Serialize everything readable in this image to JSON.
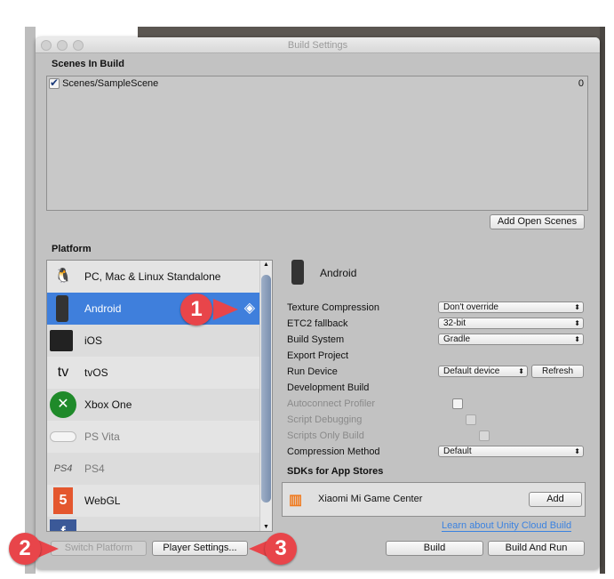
{
  "window": {
    "title": "Build Settings"
  },
  "scenes": {
    "header": "Scenes In Build",
    "items": [
      {
        "name": "Scenes/SampleScene",
        "index": "0",
        "checked": true
      }
    ],
    "add_open_scenes": "Add Open Scenes"
  },
  "platform": {
    "header": "Platform",
    "items": [
      {
        "label": "PC, Mac & Linux Standalone",
        "icon": "pc-mac-linux-icon"
      },
      {
        "label": "Android",
        "icon": "android-icon",
        "selected": true,
        "active": true
      },
      {
        "label": "iOS",
        "icon": "ios-icon"
      },
      {
        "label": "tvOS",
        "icon": "tvos-icon"
      },
      {
        "label": "Xbox One",
        "icon": "xbox-icon"
      },
      {
        "label": "PS Vita",
        "icon": "ps-vita-icon"
      },
      {
        "label": "PS4",
        "icon": "ps4-icon"
      },
      {
        "label": "WebGL",
        "icon": "html5-icon"
      }
    ]
  },
  "settings": {
    "platform_title": "Android",
    "texture_compression": {
      "label": "Texture Compression",
      "value": "Don't override"
    },
    "etc2_fallback": {
      "label": "ETC2 fallback",
      "value": "32-bit"
    },
    "build_system": {
      "label": "Build System",
      "value": "Gradle"
    },
    "export_project": {
      "label": "Export Project"
    },
    "run_device": {
      "label": "Run Device",
      "value": "Default device",
      "refresh": "Refresh"
    },
    "development_build": {
      "label": "Development Build"
    },
    "autoconnect_profiler": {
      "label": "Autoconnect Profiler"
    },
    "script_debugging": {
      "label": "Script Debugging"
    },
    "scripts_only_build": {
      "label": "Scripts Only Build"
    },
    "compression_method": {
      "label": "Compression Method",
      "value": "Default"
    },
    "sdks_header": "SDKs for App Stores",
    "sdk": {
      "name": "Xiaomi Mi Game Center",
      "add": "Add",
      "logo": "mi"
    },
    "cloud_link": "Learn about Unity Cloud Build"
  },
  "buttons": {
    "switch_platform": "Switch Platform",
    "player_settings": "Player Settings...",
    "build": "Build",
    "build_and_run": "Build And Run"
  },
  "markers": [
    "1",
    "2",
    "3"
  ],
  "colors": {
    "selection": "#3f7fdc",
    "marker": "#e8454a",
    "link": "#3b82e0"
  },
  "tv_text": "tv",
  "ps4_text": "PS4"
}
